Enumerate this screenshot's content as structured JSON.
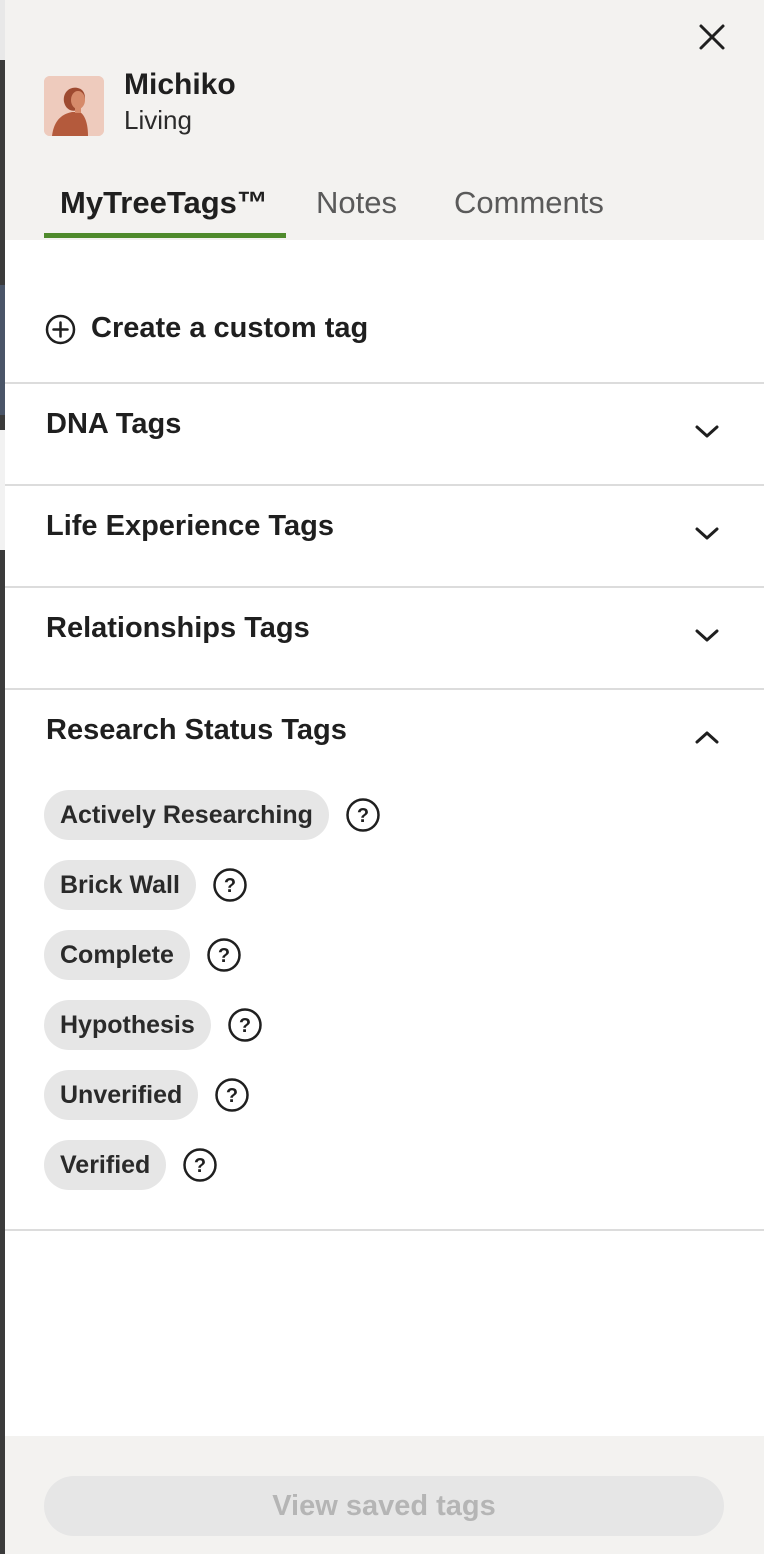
{
  "header": {
    "name": "Michiko",
    "status": "Living",
    "close_icon": "close-icon"
  },
  "tabs": [
    {
      "label": "MyTreeTags™",
      "active": true
    },
    {
      "label": "Notes",
      "active": false
    },
    {
      "label": "Comments",
      "active": false
    }
  ],
  "create_tag": {
    "label": "Create a custom tag",
    "icon": "plus-circle-icon"
  },
  "sections": [
    {
      "title": "DNA Tags",
      "expanded": false
    },
    {
      "title": "Life Experience Tags",
      "expanded": false
    },
    {
      "title": "Relationships Tags",
      "expanded": false
    },
    {
      "title": "Research Status Tags",
      "expanded": true
    }
  ],
  "research_status_tags": [
    {
      "label": "Actively Researching"
    },
    {
      "label": "Brick Wall"
    },
    {
      "label": "Complete"
    },
    {
      "label": "Hypothesis"
    },
    {
      "label": "Unverified"
    },
    {
      "label": "Verified"
    }
  ],
  "footer": {
    "view_saved_label": "View saved tags",
    "disabled": true
  },
  "colors": {
    "accent_green": "#4e8a2c",
    "header_bg": "#f3f2f0",
    "pill_bg": "#e6e6e6",
    "avatar_bg": "#eecbbd",
    "avatar_figure": "#b45a3c"
  }
}
